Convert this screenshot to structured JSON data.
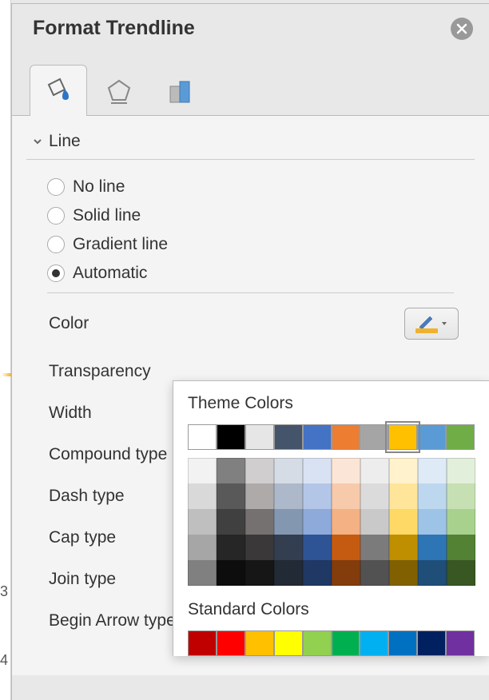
{
  "panel": {
    "title": "Format Trendline"
  },
  "section": {
    "title": "Line"
  },
  "line_options": [
    {
      "label": "No line",
      "selected": false
    },
    {
      "label": "Solid line",
      "selected": false
    },
    {
      "label": "Gradient line",
      "selected": false
    },
    {
      "label": "Automatic",
      "selected": true
    }
  ],
  "properties": {
    "color": "Color",
    "transparency": "Transparency",
    "width": "Width",
    "compound_type": "Compound type",
    "dash_type": "Dash type",
    "cap_type": "Cap type",
    "join_type": "Join type",
    "begin_arrow": "Begin Arrow type"
  },
  "color_picker": {
    "current": "#f0b12c",
    "theme_label": "Theme Colors",
    "theme_colors": [
      "#ffffff",
      "#000000",
      "#e7e6e6",
      "#44546a",
      "#4472c4",
      "#ed7d31",
      "#a5a5a5",
      "#ffc000",
      "#5b9bd5",
      "#70ad47"
    ],
    "selected_theme_index": 7,
    "theme_shades": [
      [
        "#f2f2f2",
        "#d9d9d9",
        "#bfbfbf",
        "#a6a6a6",
        "#808080"
      ],
      [
        "#808080",
        "#595959",
        "#404040",
        "#262626",
        "#0d0d0d"
      ],
      [
        "#d0cece",
        "#aeaaaa",
        "#757171",
        "#3a3838",
        "#161616"
      ],
      [
        "#d6dce5",
        "#adb9ca",
        "#8497b0",
        "#333f50",
        "#222a35"
      ],
      [
        "#d9e2f3",
        "#b4c6e7",
        "#8eaadb",
        "#2f5496",
        "#1f3864"
      ],
      [
        "#fbe5d6",
        "#f7caac",
        "#f4b183",
        "#c55a11",
        "#833c0c"
      ],
      [
        "#ededed",
        "#dbdbdb",
        "#c9c9c9",
        "#7b7b7b",
        "#525252"
      ],
      [
        "#fff2cc",
        "#ffe599",
        "#ffd966",
        "#bf8f00",
        "#806000"
      ],
      [
        "#deebf7",
        "#bdd7ee",
        "#9dc3e6",
        "#2e75b6",
        "#1f4e79"
      ],
      [
        "#e2efda",
        "#c6e0b4",
        "#a9d18e",
        "#548235",
        "#385723"
      ]
    ],
    "standard_label": "Standard Colors",
    "standard_colors": [
      "#c00000",
      "#ff0000",
      "#ffc000",
      "#ffff00",
      "#92d050",
      "#00b050",
      "#00b0f0",
      "#0070c0",
      "#002060",
      "#7030a0"
    ]
  },
  "left_cell": "3",
  "left_cell2": "4"
}
